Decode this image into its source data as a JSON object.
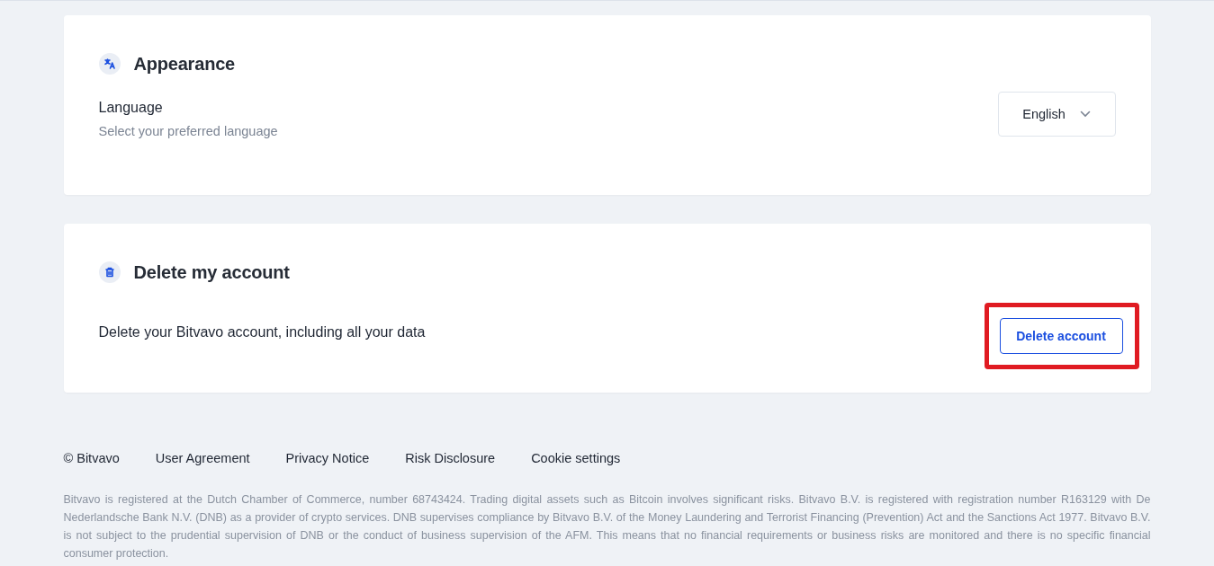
{
  "sections": [
    {
      "kind": "appearance",
      "title": "Appearance",
      "setting": {
        "label": "Language",
        "description": "Select your preferred language"
      },
      "dropdown": {
        "value": "English"
      }
    },
    {
      "kind": "delete",
      "title": "Delete my account",
      "setting": {
        "description": "Delete your Bitvavo account, including all your data"
      },
      "button": {
        "label": "Delete account",
        "highlighted": true
      }
    }
  ],
  "footer": {
    "links": [
      "© Bitvavo",
      "User Agreement",
      "Privacy Notice",
      "Risk Disclosure",
      "Cookie settings"
    ],
    "disclaimer": "Bitvavo is registered at the Dutch Chamber of Commerce, number 68743424. Trading digital assets such as Bitcoin involves significant risks. Bitvavo B.V. is registered with registration number R163129 with De Nederlandsche Bank N.V. (DNB) as a provider of crypto services. DNB supervises compliance by Bitvavo B.V. of the Money Laundering and Terrorist Financing (Prevention) Act and the Sanctions Act 1977. Bitvavo B.V. is not subject to the prudential supervision of DNB or the conduct of business supervision of the AFM. This means that no financial requirements or business risks are monitored and there is no specific financial consumer protection."
  }
}
